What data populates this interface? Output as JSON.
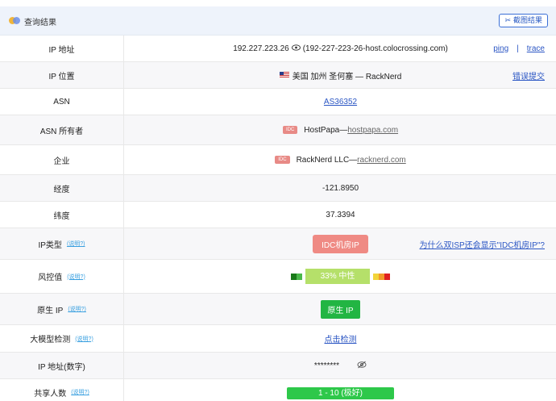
{
  "header": {
    "title": "查询结果",
    "screenshot_button": "截图结果"
  },
  "rows": {
    "ip": {
      "label": "IP 地址",
      "value": "192.227.223.26",
      "hostname": "(192-227-223-26-host.colocrossing.com)",
      "ping": "ping",
      "sep": "|",
      "trace": "trace"
    },
    "location": {
      "label": "IP 位置",
      "value": "美国 加州 圣何塞 — RackNerd",
      "report": "错误提交"
    },
    "asn": {
      "label": "ASN",
      "value": "AS36352"
    },
    "asn_owner": {
      "label": "ASN 所有者",
      "tag": "IDC",
      "name": "HostPapa",
      "dash": "—",
      "domain": "hostpapa.com"
    },
    "company": {
      "label": "企业",
      "tag": "IDC",
      "name": "RackNerd LLC",
      "dash": "—",
      "domain": "racknerd.com"
    },
    "longitude": {
      "label": "经度",
      "value": "-121.8950"
    },
    "latitude": {
      "label": "纬度",
      "value": "37.3394"
    },
    "ip_type": {
      "label": "IP类型",
      "help": "(说明?)",
      "value": "IDC机房IP",
      "question": "为什么双ISP还会显示\"IDC机房IP\"?"
    },
    "risk": {
      "label": "风控值",
      "help": "(说明?)",
      "value": "33%   中性",
      "percent": 33
    },
    "native": {
      "label": "原生 IP",
      "help": "(说明?)",
      "value": "原生 IP"
    },
    "llm": {
      "label": "大模型检测",
      "help": "(说明?)",
      "value": "点击检测"
    },
    "ip_number": {
      "label": "IP 地址(数字)",
      "value": "********"
    },
    "shared": {
      "label": "共享人数",
      "help": "(说明?)",
      "value": "1 - 10 (极好)"
    }
  },
  "colors": {
    "accent": "#2b56c4",
    "idc_red": "#ef8a84",
    "green": "#22b543",
    "risk_mid": "#b5e06a"
  },
  "icons": {
    "header": "logo-dots-icon",
    "screenshot": "scissors-icon",
    "eye": "eye-icon",
    "eye_hidden": "eye-off-icon",
    "flag": "us-flag-icon"
  }
}
